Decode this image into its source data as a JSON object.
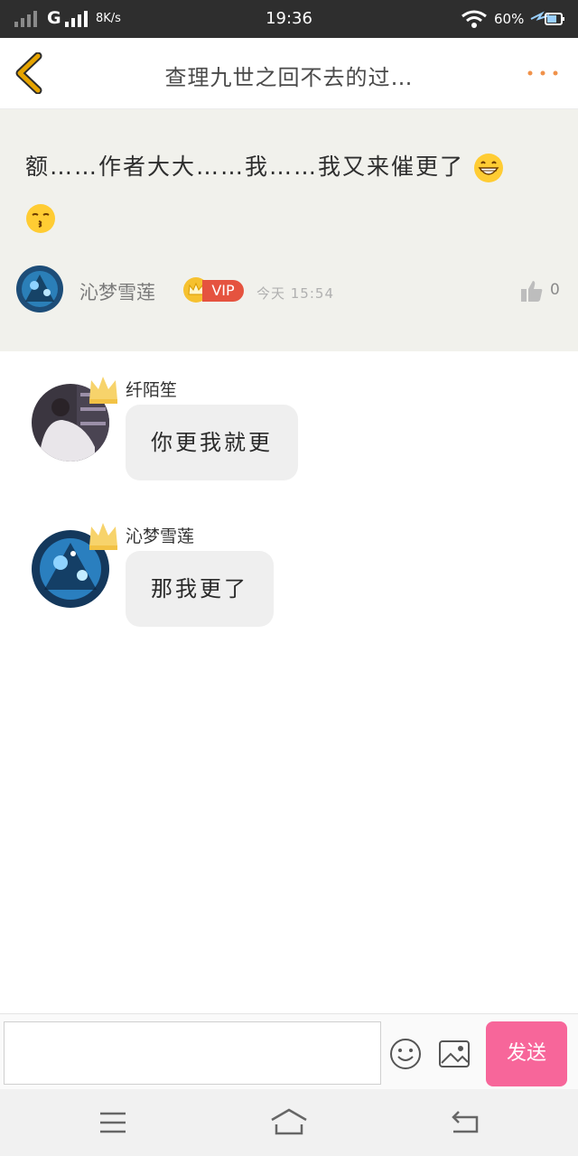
{
  "status_bar": {
    "network": "G",
    "speed": "8K/s",
    "time": "19:36",
    "battery": "60%"
  },
  "header": {
    "title": "查理九世之回不去的过…",
    "back_icon": "chevron-left-icon",
    "more_icon": "more-dots-icon"
  },
  "post": {
    "text_line1": "额……作者大大……我……我又来催更了",
    "author": "沁梦雪莲",
    "badge": "VIP",
    "time": "今天 15:54",
    "likes": "0"
  },
  "replies": [
    {
      "name": "纤陌笙",
      "message": "你更我就更"
    },
    {
      "name": "沁梦雪莲",
      "message": "那我更了"
    }
  ],
  "input": {
    "placeholder": "",
    "send_label": "发送"
  },
  "colors": {
    "accent": "#f7669a",
    "vip": "#e5533f",
    "back": "#e6a400",
    "more": "#f0924a",
    "post_bg": "#f1f1ec"
  }
}
